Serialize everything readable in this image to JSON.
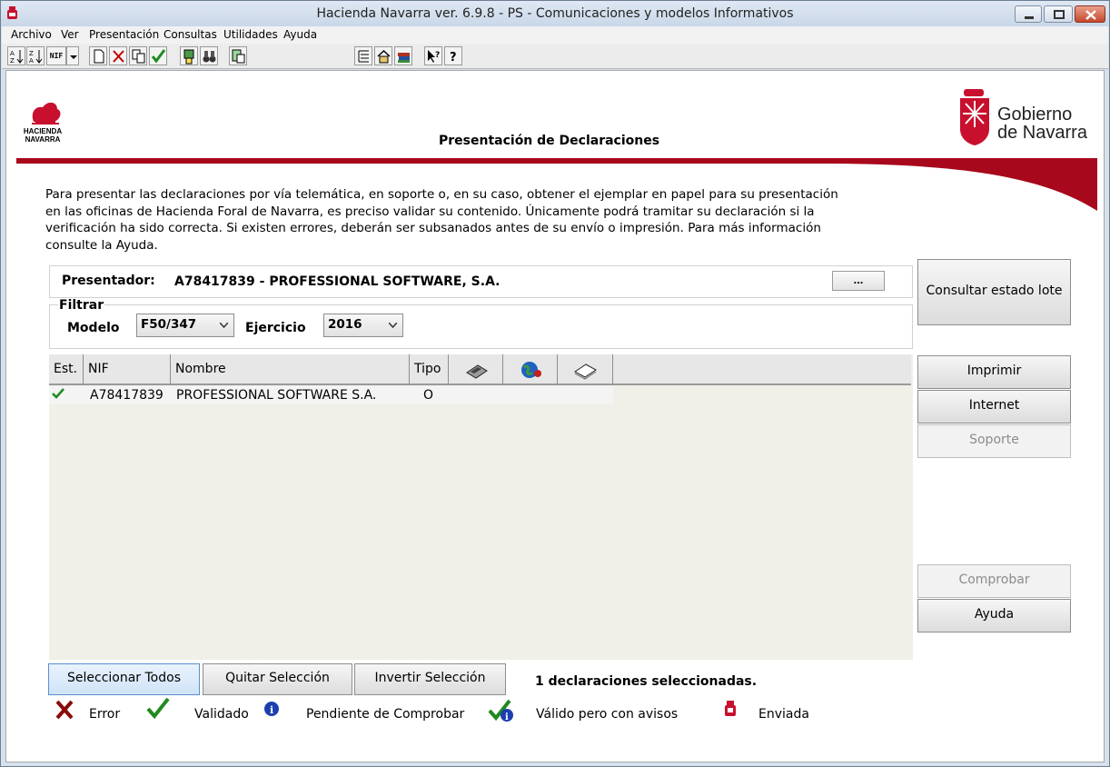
{
  "window": {
    "title": "Hacienda Navarra ver. 6.9.8 - PS - Comunicaciones y modelos Informativos"
  },
  "menu": [
    "Archivo",
    "Ver",
    "Presentación",
    "Consultas",
    "Utilidades",
    "Ayuda"
  ],
  "toolbar": {
    "nif_label": "NIF"
  },
  "header": {
    "hacienda_logo_line1": "HACIENDA",
    "hacienda_logo_line2": "NAVARRA",
    "page_title": "Presentación de Declaraciones",
    "gobierno_line1": "Gobierno",
    "gobierno_line2": "de Navarra"
  },
  "intro_text": "Para presentar las declaraciones por vía telemática, en soporte o, en su caso, obtener el ejemplar en papel para su presentación en las oficinas de Hacienda Foral de Navarra, es preciso validar su contenido. Únicamente podrá tramitar su declaración si la verificación ha sido correcta. Si existen errores, deberán ser subsanados antes de su envío o impresión. Para más información consulte la Ayuda.",
  "presenter": {
    "label": "Presentador:",
    "value": "A78417839 - PROFESSIONAL SOFTWARE, S.A.",
    "browse_label": "..."
  },
  "filter": {
    "legend": "Filtrar",
    "model_label": "Modelo",
    "model_value": "F50/347",
    "year_label": "Ejercicio",
    "year_value": "2016"
  },
  "grid": {
    "columns": [
      "Est.",
      "NIF",
      "Nombre",
      "Tipo"
    ],
    "icon_columns": [
      "floppy-disk-icon",
      "globe-icon",
      "paper-icon"
    ],
    "rows": [
      {
        "status": "validated",
        "nif": "A78417839",
        "nombre": "PROFESSIONAL SOFTWARE S.A.",
        "tipo": "O"
      }
    ]
  },
  "side_buttons": {
    "consultar": "Consultar estado lote",
    "imprimir": "Imprimir",
    "internet": "Internet",
    "soporte": "Soporte",
    "comprobar": "Comprobar",
    "ayuda": "Ayuda"
  },
  "bottom": {
    "select_all": "Seleccionar Todos",
    "clear_selection": "Quitar Selección",
    "invert_selection": "Invertir Selección",
    "selected_count": "1 declaraciones seleccionadas."
  },
  "legend": {
    "error": "Error",
    "validated": "Validado",
    "pending": "Pendiente de Comprobar",
    "warnings": "Válido pero con avisos",
    "sent": "Enviada"
  },
  "colors": {
    "accent_red": "#b3001b",
    "check_green": "#1f8a1f"
  }
}
